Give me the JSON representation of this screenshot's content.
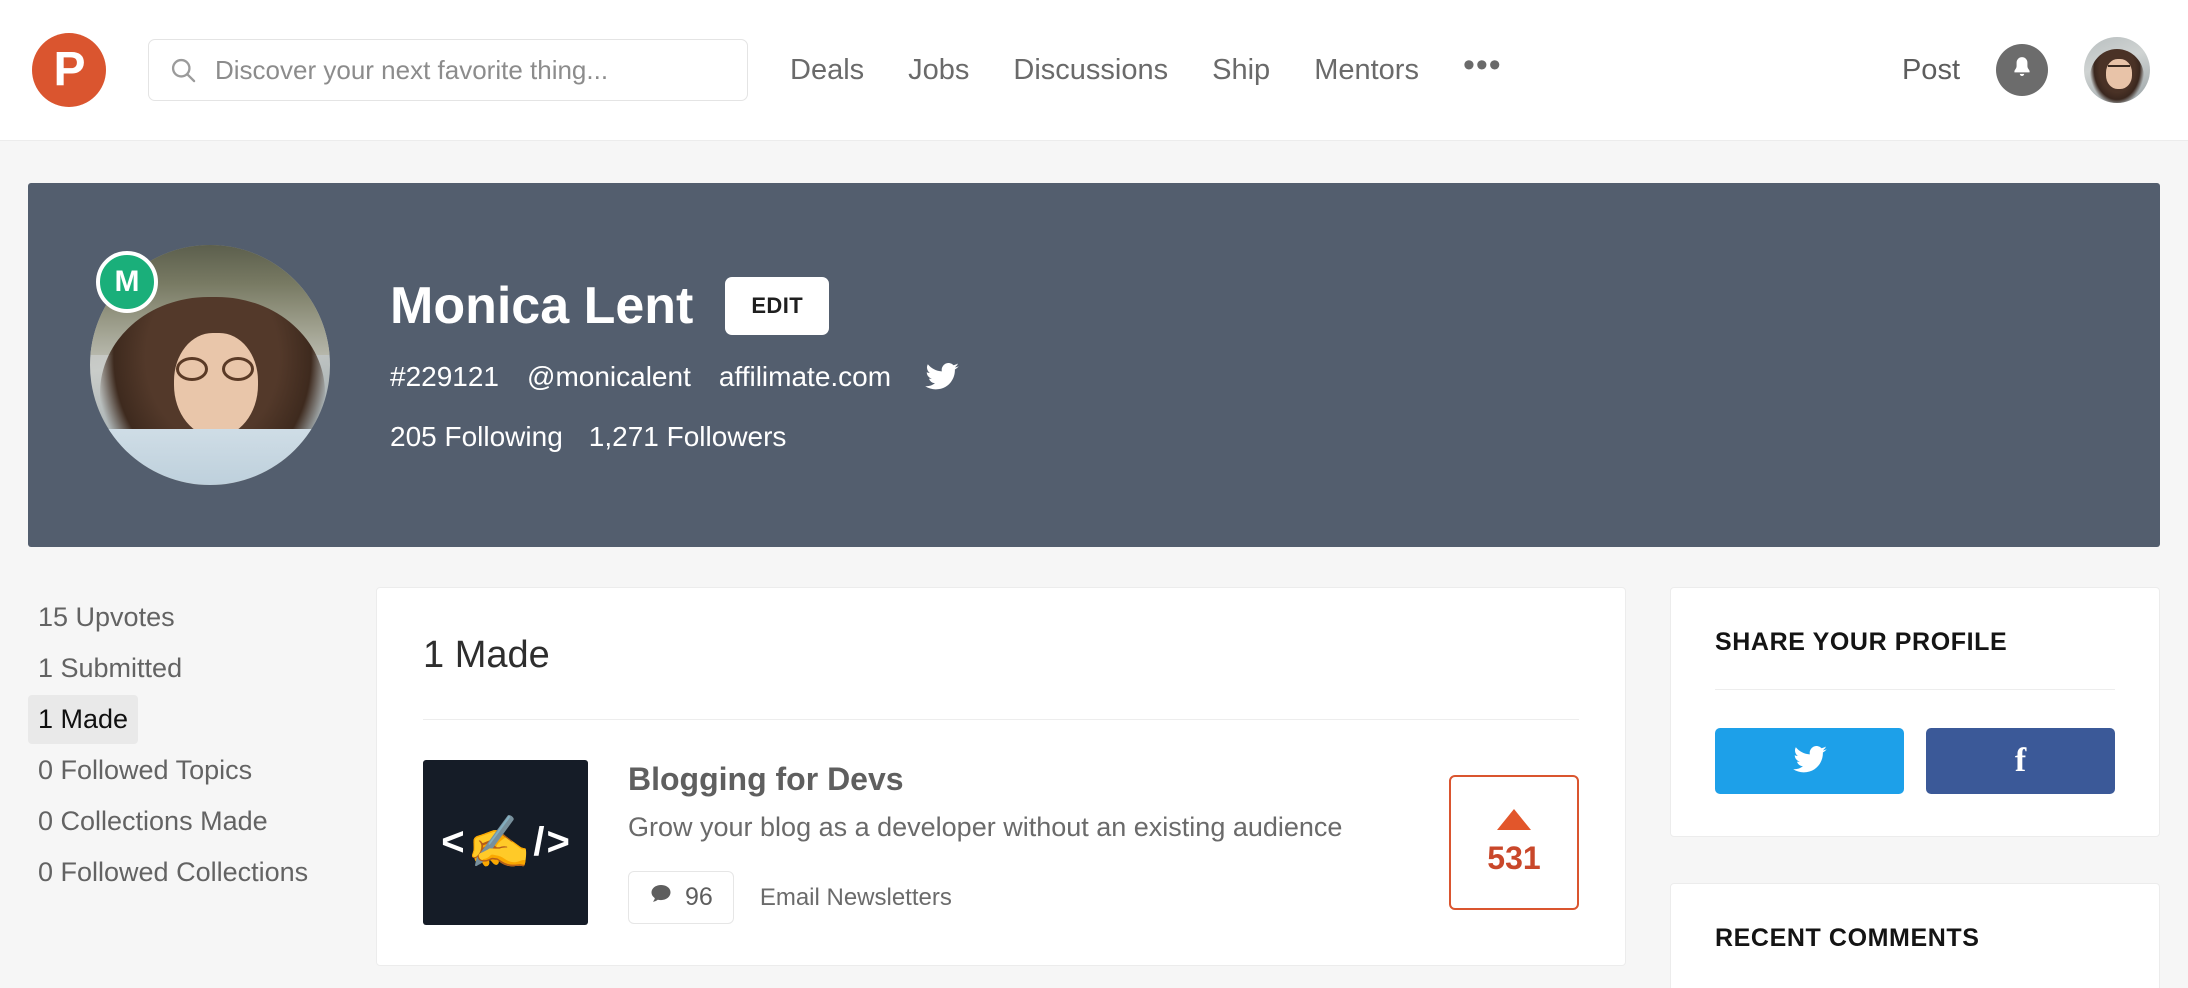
{
  "nav": {
    "logo_letter": "P",
    "search_placeholder": "Discover your next favorite thing...",
    "search_value": "",
    "links": [
      {
        "label": "Deals"
      },
      {
        "label": "Jobs"
      },
      {
        "label": "Discussions"
      },
      {
        "label": "Ship"
      },
      {
        "label": "Mentors"
      },
      {
        "label": "•••"
      }
    ],
    "post_label": "Post"
  },
  "profile": {
    "maker_badge_letter": "M",
    "name": "Monica Lent",
    "edit_label": "EDIT",
    "user_number": "#229121",
    "handle": "@monicalent",
    "website": "affilimate.com",
    "following": "205 Following",
    "followers": "1,271 Followers",
    "banner_color": "#535e6e"
  },
  "left_rail": {
    "items": [
      {
        "label": "15 Upvotes",
        "active": false
      },
      {
        "label": "1 Submitted",
        "active": false
      },
      {
        "label": "1 Made",
        "active": true
      },
      {
        "label": "0 Followed Topics",
        "active": false
      },
      {
        "label": "0 Collections Made",
        "active": false
      },
      {
        "label": "0 Followed Collections",
        "active": false
      }
    ]
  },
  "main": {
    "title": "1 Made",
    "posts": [
      {
        "name": "Blogging for Devs",
        "tagline": "Grow your blog as a developer without an existing audience",
        "comments": "96",
        "topic": "Email Newsletters",
        "votes": "531",
        "thumb_left": "<",
        "thumb_emoji": "✍️",
        "thumb_slash": "/",
        "thumb_right": ">"
      }
    ]
  },
  "right_rail": {
    "share_card_title": "SHARE YOUR PROFILE",
    "twitter_label": "Share on Twitter",
    "facebook_label": "Share on Facebook",
    "recent_comments_title": "RECENT COMMENTS"
  },
  "colors": {
    "brand": "#da552f",
    "twitter": "#1da0e9",
    "facebook": "#3b5998",
    "maker_green": "#1aaf7a"
  }
}
